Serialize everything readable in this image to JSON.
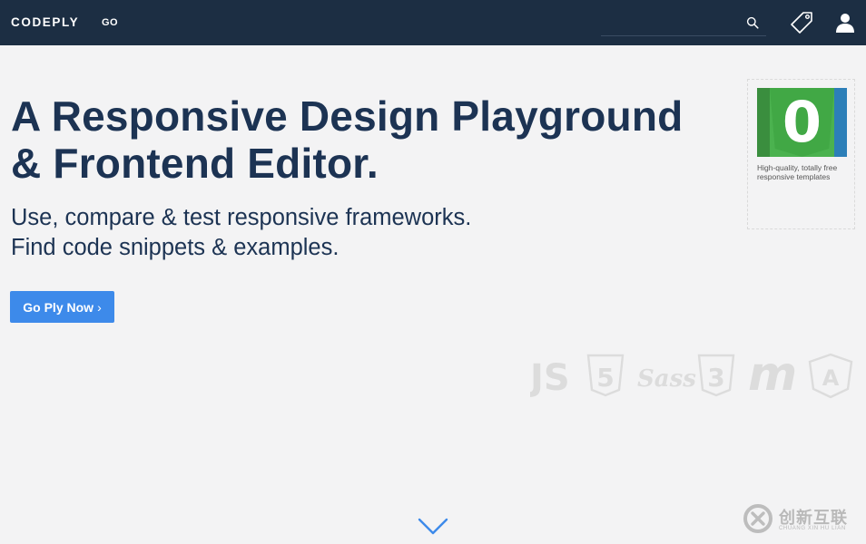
{
  "navbar": {
    "brand": "CODEPLY",
    "go_label": "GO",
    "search": {
      "value": "",
      "placeholder": ""
    },
    "icons": [
      "search-icon",
      "tag-icon",
      "user-icon"
    ]
  },
  "hero": {
    "title_line1": "A Responsive Design Playground",
    "title_line2": "& Frontend Editor.",
    "subtitle_line1": "Use, compare & test responsive frameworks.",
    "subtitle_line2": "Find code snippets & examples.",
    "cta_label": "Go Ply Now",
    "cta_chevron": "›"
  },
  "ad": {
    "image_text": "0",
    "caption_line1": "High-quality, totally free",
    "caption_line2": "responsive templates"
  },
  "tech_logos": {
    "js": "JS",
    "html5": "5",
    "sass": "Sass",
    "css3": "3",
    "materialize": "m",
    "angular": "A"
  },
  "watermark": {
    "cn": "创新互联",
    "en": "CHUANG XIN HU LIAN"
  },
  "colors": {
    "navbar": "#1c2e43",
    "accent": "#3d8aea",
    "heading": "#1c3353",
    "background": "#f3f3f4"
  }
}
